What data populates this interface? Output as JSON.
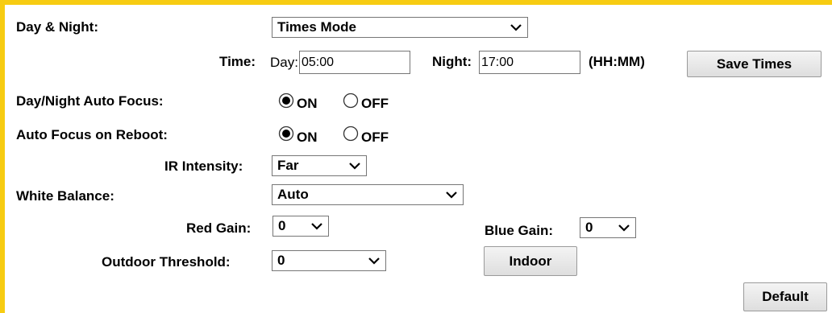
{
  "day_night": {
    "label": "Day & Night:",
    "mode_value": "Times Mode",
    "time_label": "Time:",
    "day_label": "Day:",
    "day_value": "05:00",
    "night_label": "Night:",
    "night_value": "17:00",
    "format_hint": "(HH:MM)",
    "save_button": "Save Times"
  },
  "auto_focus": {
    "label": "Day/Night Auto Focus:",
    "on_label": "ON",
    "off_label": "OFF",
    "selected": "ON"
  },
  "focus_reboot": {
    "label": "Auto Focus on Reboot:",
    "on_label": "ON",
    "off_label": "OFF",
    "selected": "ON"
  },
  "ir": {
    "label": "IR Intensity:",
    "value": "Far"
  },
  "white_balance": {
    "label": "White Balance:",
    "value": "Auto"
  },
  "gain": {
    "red_label": "Red Gain:",
    "red_value": "0",
    "blue_label": "Blue Gain:",
    "blue_value": "0"
  },
  "outdoor": {
    "label": "Outdoor Threshold:",
    "value": "0",
    "indoor_button": "Indoor"
  },
  "default_button": "Default",
  "colors": {
    "frame": "#f7cc12"
  }
}
